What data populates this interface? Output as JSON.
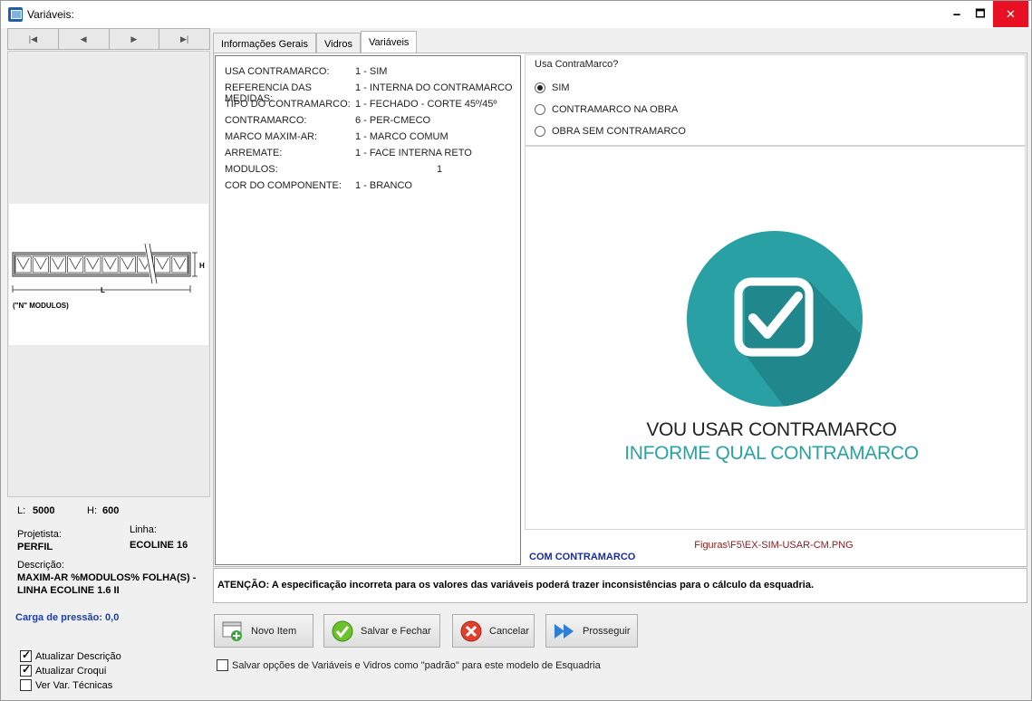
{
  "window": {
    "title": "Variáveis:",
    "minimize": "🗕",
    "maximize": "🗖",
    "close": "✕"
  },
  "nav": [
    "|◀",
    "◀",
    "▶",
    "▶|"
  ],
  "preview": {
    "croqui_caption": "(\"N\" MODULOS)",
    "h_mark": "H",
    "l_mark": "L"
  },
  "info": {
    "l_label": "L:",
    "l_value": "5000",
    "h_label": "H:",
    "h_value": "600",
    "projetista_label": "Projetista:",
    "projetista_value": "PERFIL",
    "linha_label": "Linha:",
    "linha_value": "ECOLINE 16",
    "descricao_label": "Descrição:",
    "descricao_value_1": "MAXIM-AR %MODULOS% FOLHA(S) -",
    "descricao_value_2": "LINHA ECOLINE 1.6 II",
    "carga": "Carga de pressão: 0,0"
  },
  "options": [
    {
      "label": "Atualizar Descrição",
      "checked": true
    },
    {
      "label": "Atualizar Croqui",
      "checked": true
    },
    {
      "label": "Ver Var. Técnicas",
      "checked": false
    }
  ],
  "tabs": [
    {
      "label": "Informações Gerais",
      "active": false
    },
    {
      "label": "Vidros",
      "active": false
    },
    {
      "label": "Variáveis",
      "active": true
    }
  ],
  "variables": [
    {
      "key": "USA CONTRAMARCO:",
      "value": "1 - SIM"
    },
    {
      "key": "REFERENCIA DAS MEDIDAS:",
      "value": "1 - INTERNA DO CONTRAMARCO"
    },
    {
      "key": "TIPO DO CONTRAMARCO:",
      "value": "1 - FECHADO - CORTE 45º/45º"
    },
    {
      "key": "CONTRAMARCO:",
      "value": "6 - PER-CMECO"
    },
    {
      "key": "MARCO MAXIM-AR:",
      "value": "1 - MARCO COMUM"
    },
    {
      "key": "ARREMATE:",
      "value": "1 - FACE INTERNA RETO"
    },
    {
      "key": "MODULOS:",
      "value": "1"
    },
    {
      "key": "COR DO COMPONENTE:",
      "value": "1 - BRANCO"
    }
  ],
  "question": {
    "title": "Usa ContraMarco?",
    "options": [
      {
        "label": "SIM",
        "selected": true
      },
      {
        "label": "CONTRAMARCO NA OBRA",
        "selected": false
      },
      {
        "label": "OBRA SEM CONTRAMARCO",
        "selected": false
      }
    ]
  },
  "figure": {
    "title": "VOU USAR CONTRAMARCO",
    "subtitle": "INFORME QUAL CONTRAMARCO",
    "path": "Figuras\\F5\\EX-SIM-USAR-CM.PNG",
    "caption": "COM CONTRAMARCO",
    "circle_color": "#29a0a3",
    "shadow_color": "#1f8589"
  },
  "warning": "ATENÇÃO: A especificação incorreta para os valores das variáveis poderá trazer inconsistências para o cálculo da esquadria.",
  "buttons": [
    {
      "label": "Novo Item",
      "icon": "new-item-icon"
    },
    {
      "label": "Salvar e Fechar",
      "icon": "check-icon"
    },
    {
      "label": "Cancelar",
      "icon": "cancel-icon"
    },
    {
      "label": "Prosseguir",
      "icon": "forward-icon"
    }
  ],
  "save_default": {
    "label": "Salvar opções de Variáveis e Vidros como \"padrão\" para este modelo de Esquadria",
    "checked": false
  }
}
